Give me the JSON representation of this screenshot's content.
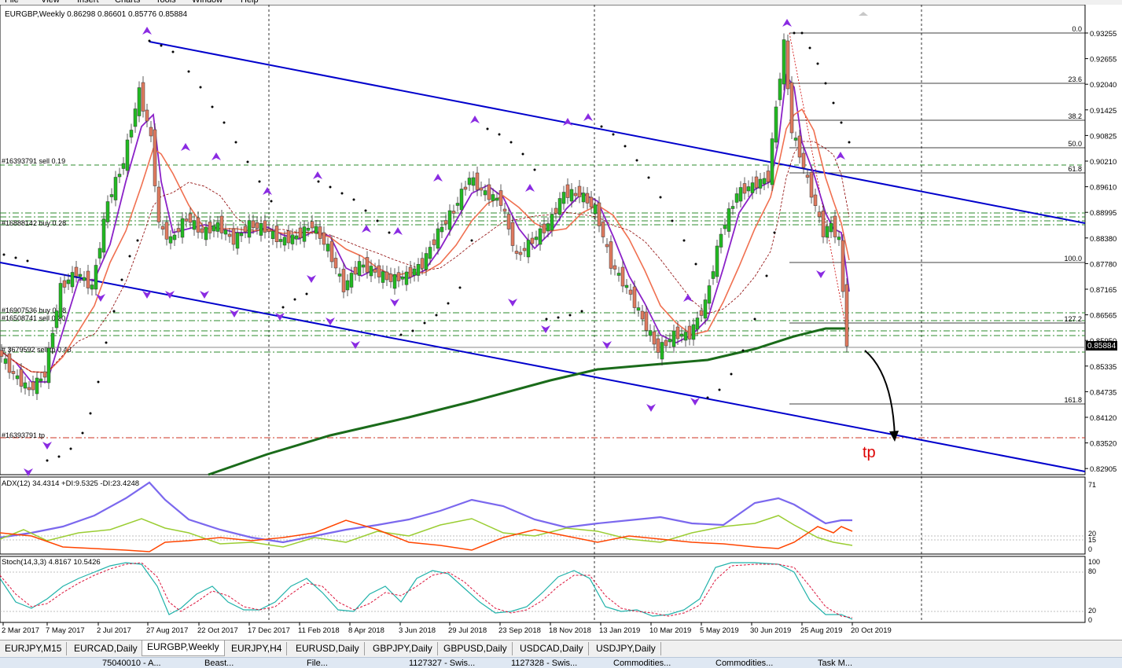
{
  "menu": {
    "items": [
      "File",
      "View",
      "Insert",
      "Charts",
      "Tools",
      "Window",
      "Help"
    ]
  },
  "chart": {
    "header": "EURGBP,Weekly  0.86298 0.86601 0.85776 0.85884",
    "current_price": "0.85884",
    "tp_annotation": "tp",
    "orders": [
      "#16393791 sell 0.19",
      "#16888142 buy 0.28",
      "#16907536 buy 0.28",
      "#16508741 sell 0.20",
      "#16393791 tp",
      "# 3679592 sell tp 0.46"
    ],
    "price_ticks": [
      "0.93255",
      "0.92655",
      "0.92040",
      "0.91425",
      "0.90825",
      "0.90210",
      "0.89610",
      "0.88995",
      "0.88380",
      "0.87780",
      "0.87165",
      "0.86565",
      "0.85950",
      "0.85335",
      "0.84735",
      "0.84120",
      "0.83520",
      "0.82905"
    ],
    "fib_labels": [
      "0.0",
      "23.6",
      "38.2",
      "50.0",
      "61.8",
      "100.0",
      "127.2",
      "161.8"
    ],
    "date_ticks": [
      "2 Mar 2017",
      "7 May 2017",
      "2 Jul 2017",
      "27 Aug 2017",
      "22 Oct 2017",
      "17 Dec 2017",
      "11 Feb 2018",
      "8 Apr 2018",
      "3 Jun 2018",
      "29 Jul 2018",
      "23 Sep 2018",
      "18 Nov 2018",
      "13 Jan 2019",
      "10 Mar 2019",
      "5 May 2019",
      "30 Jun 2019",
      "25 Aug 2019",
      "20 Oct 2019"
    ]
  },
  "adx": {
    "label": "ADX(12) 34.4314 +DI:9.5325 -DI:23.4248",
    "ticks": [
      "71",
      "20",
      "15",
      "0"
    ]
  },
  "stoch": {
    "label": "Stoch(14,3,3) 4.8167 10.5426",
    "ticks": [
      "100",
      "80",
      "20",
      "0"
    ]
  },
  "tabs": [
    "EURJPY,M15",
    "EURCAD,Daily",
    "EURGBP,Weekly",
    "EURJPY,H4",
    "EURUSD,Daily",
    "GBPJPY,Daily",
    "GBPUSD,Daily",
    "USDCAD,Daily",
    "USDJPY,Daily"
  ],
  "active_tab": "EURGBP,Weekly",
  "taskbar": [
    "75040010 - A...",
    "Beast...",
    "File...",
    "1127327 - Swis...",
    "1127328 - Swis...",
    "Commodities...",
    "Commodities...",
    "Task M..."
  ],
  "colors": {
    "bull_candle": "#22bb22",
    "bear_candle": "#e07a5f",
    "channel": "#0000cc",
    "ma_long": "#1a6b1a",
    "ma_fast": "#8b22c8",
    "ma_mid": "#f07050",
    "adx_main": "#7b68ee",
    "adx_plus": "#9acd32",
    "adx_minus": "#ff4500",
    "stoch_main": "#20b2aa",
    "stoch_signal": "#dc143c",
    "fractal": "#8a2be2",
    "level_green": "#2e8b2e",
    "level_red": "#cc3322"
  }
}
